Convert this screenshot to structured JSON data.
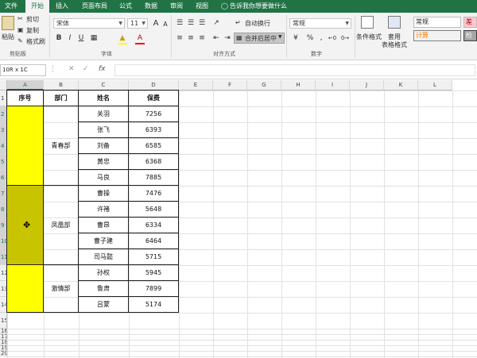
{
  "tabs": [
    "文件",
    "开始",
    "插入",
    "页面布局",
    "公式",
    "数据",
    "审阅",
    "视图"
  ],
  "tell_me": "告诉我你想要做什么",
  "ribbon": {
    "clipboard": {
      "paste": "粘贴",
      "cut": "剪切",
      "copy": "复制",
      "format_painter": "格式刷",
      "group": "剪贴板"
    },
    "font": {
      "name": "宋体",
      "size": "11",
      "bold": "B",
      "italic": "I",
      "underline": "U",
      "grow": "A",
      "shrink": "A",
      "group": "字体"
    },
    "alignment": {
      "wrap": "自动换行",
      "merge": "合并后居中",
      "group": "对齐方式"
    },
    "number": {
      "format": "常规",
      "percent": "%",
      "comma": ",",
      "group": "数字"
    },
    "styles": {
      "conditional": "条件格式",
      "table_format_1": "套用",
      "table_format_2": "表格格式",
      "normal": "常规",
      "bad": "差",
      "calc": "计算",
      "check": "检"
    }
  },
  "formula_bar": {
    "name_box": "10R x 1C",
    "cancel": "✕",
    "enter": "✓",
    "fx": "fx",
    "value": ""
  },
  "columns": [
    "A",
    "B",
    "C",
    "D",
    "E",
    "F",
    "G",
    "H",
    "I",
    "J",
    "K",
    "L"
  ],
  "rows": [
    "1",
    "2",
    "3",
    "4",
    "5",
    "6",
    "7",
    "8",
    "9",
    "10",
    "11",
    "12",
    "13",
    "14",
    "15",
    "16",
    "17",
    "18",
    "19",
    "20"
  ],
  "table": {
    "headers": [
      "序号",
      "部门",
      "姓名",
      "保费"
    ],
    "groups": [
      {
        "dept": "青春部",
        "names": [
          "关羽",
          "张飞",
          "刘备",
          "黄忠",
          "马良"
        ],
        "values": [
          "7256",
          "6393",
          "6585",
          "6368",
          "7885"
        ]
      },
      {
        "dept": "凤凰部",
        "names": [
          "曹操",
          "许褚",
          "曹昂",
          "曹子建",
          "司马懿"
        ],
        "values": [
          "7476",
          "5648",
          "6334",
          "6464",
          "5715"
        ]
      },
      {
        "dept": "激情部",
        "names": [
          "孙权",
          "鲁肃",
          "吕蒙"
        ],
        "values": [
          "5945",
          "7899",
          "5174"
        ]
      }
    ]
  },
  "colors": {
    "excel_green": "#217346",
    "fill_yellow": "#ffff00",
    "selection_fill": "#c9c400"
  },
  "cursor_icon": "plus-cross-cursor"
}
